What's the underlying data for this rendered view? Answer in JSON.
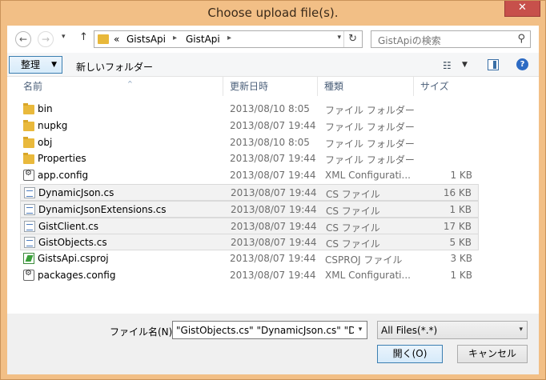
{
  "window": {
    "title": "Choose upload file(s).",
    "close_glyph": "✕"
  },
  "nav": {
    "back_glyph": "←",
    "forward_glyph": "→",
    "recent_glyph": "▾",
    "up_glyph": "↑",
    "breadcrumb": [
      "«",
      "GistsApi",
      "GistApi"
    ],
    "crumb_sep": "▸",
    "addr_chevron": "▾",
    "refresh_glyph": "↻",
    "search_placeholder": "GistApiの検索",
    "search_glyph": "⚲"
  },
  "toolbar": {
    "organize_label": "整理",
    "organize_caret": "▼",
    "new_folder_label": "新しいフォルダー",
    "view_glyph": "☷",
    "view_caret": "▼",
    "help_glyph": "?"
  },
  "columns": [
    "名前",
    "更新日時",
    "種類",
    "サイズ"
  ],
  "sort_glyph": "^",
  "files": [
    {
      "name": "bin",
      "date": "2013/08/10 8:05",
      "type": "ファイル フォルダー",
      "size": "",
      "icon": "folder-icon",
      "selected": false
    },
    {
      "name": "nupkg",
      "date": "2013/08/07 19:44",
      "type": "ファイル フォルダー",
      "size": "",
      "icon": "folder-icon",
      "selected": false
    },
    {
      "name": "obj",
      "date": "2013/08/10 8:05",
      "type": "ファイル フォルダー",
      "size": "",
      "icon": "folder-icon",
      "selected": false
    },
    {
      "name": "Properties",
      "date": "2013/08/07 19:44",
      "type": "ファイル フォルダー",
      "size": "",
      "icon": "folder-icon",
      "selected": false
    },
    {
      "name": "app.config",
      "date": "2013/08/07 19:44",
      "type": "XML Configurati...",
      "size": "1 KB",
      "icon": "config-file-icon",
      "selected": false
    },
    {
      "name": "DynamicJson.cs",
      "date": "2013/08/07 19:44",
      "type": "CS ファイル",
      "size": "16 KB",
      "icon": "cs-file-icon",
      "selected": true
    },
    {
      "name": "DynamicJsonExtensions.cs",
      "date": "2013/08/07 19:44",
      "type": "CS ファイル",
      "size": "1 KB",
      "icon": "cs-file-icon",
      "selected": true
    },
    {
      "name": "GistClient.cs",
      "date": "2013/08/07 19:44",
      "type": "CS ファイル",
      "size": "17 KB",
      "icon": "cs-file-icon",
      "selected": true
    },
    {
      "name": "GistObjects.cs",
      "date": "2013/08/07 19:44",
      "type": "CS ファイル",
      "size": "5 KB",
      "icon": "cs-file-icon",
      "selected": true
    },
    {
      "name": "GistsApi.csproj",
      "date": "2013/08/07 19:44",
      "type": "CSPROJ ファイル",
      "size": "3 KB",
      "icon": "csproj-file-icon",
      "selected": false
    },
    {
      "name": "packages.config",
      "date": "2013/08/07 19:44",
      "type": "XML Configurati...",
      "size": "1 KB",
      "icon": "config-file-icon",
      "selected": false
    }
  ],
  "footer": {
    "filename_label": "ファイル名(N):",
    "filename_value": "\"GistObjects.cs\" \"DynamicJson.cs\" \"Dy",
    "filename_caret": "▾",
    "filter_value": "All Files(*.*)",
    "filter_caret": "▾",
    "open_label": "開く(O)",
    "cancel_label": "キャンセル"
  },
  "colors": {
    "frame": "#f2bf86",
    "close": "#c7504b",
    "accent": "#3c7fb1"
  }
}
